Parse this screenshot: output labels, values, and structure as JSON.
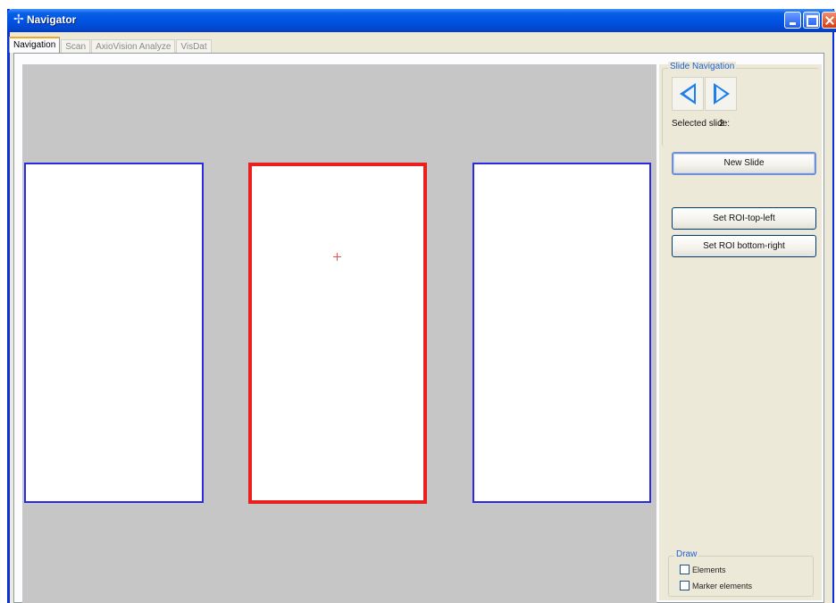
{
  "window": {
    "title": "Navigator",
    "icon": "app-icon",
    "controls": [
      "minimize-icon",
      "maximize-icon",
      "close-icon"
    ]
  },
  "tabs": [
    {
      "label": "Navigation",
      "active": true
    },
    {
      "label": "Scan",
      "active": false
    },
    {
      "label": "AxioVision Analyze",
      "active": false
    },
    {
      "label": "VisDat",
      "active": false
    }
  ],
  "canvas": {
    "background": "#c6c6c6",
    "slides": [
      {
        "index": 1,
        "border_color": "#2a2ae0",
        "selected": false
      },
      {
        "index": 2,
        "border_color": "#e82020",
        "selected": true
      },
      {
        "index": 3,
        "border_color": "#2a2ae0",
        "selected": false
      }
    ]
  },
  "slide_navigation": {
    "legend": "Slide Navigation",
    "prev_icon": "arrow-left-icon",
    "next_icon": "arrow-right-icon",
    "selected_label": "Selected slide:",
    "selected_value": "2",
    "new_slide_label": "New Slide",
    "set_roi_top_left_label": "Set ROI-top-left",
    "set_roi_bottom_right_label": "Set ROI bottom-right"
  },
  "draw": {
    "legend": "Draw",
    "elements_label": "Elements",
    "elements_checked": false,
    "marker_elements_label": "Marker elements",
    "marker_elements_checked": false
  },
  "colors": {
    "titlebar": "#0054e3",
    "selected_slide": "#e82020",
    "slide_border": "#2a2ae0",
    "arrow": "#1e7fe8"
  }
}
